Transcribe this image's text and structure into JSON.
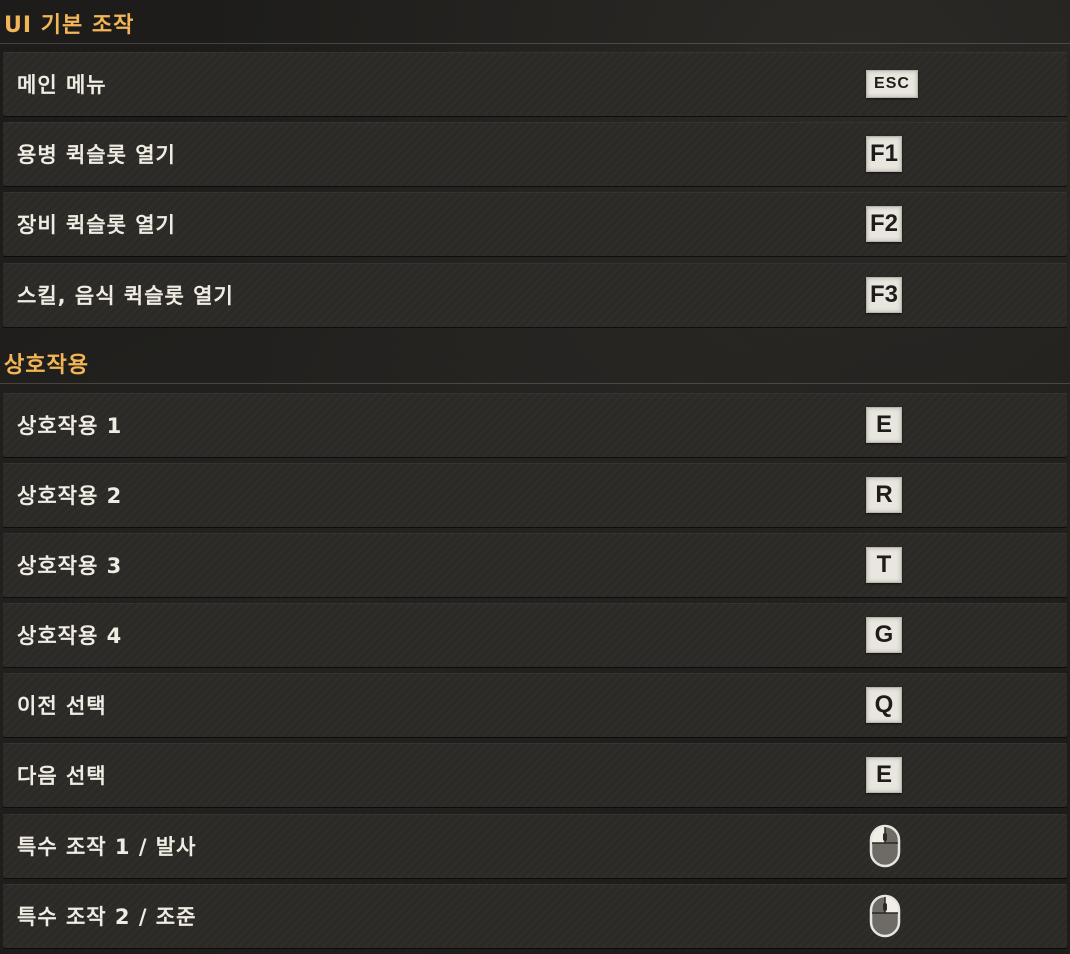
{
  "sections": [
    {
      "title": "UI 기본 조작",
      "items": [
        {
          "label": "메인 메뉴",
          "key": "ESC",
          "icon": "esc-key"
        },
        {
          "label": "용병 퀵슬롯 열기",
          "key": "F1",
          "icon": "f1-key"
        },
        {
          "label": "장비 퀵슬롯 열기",
          "key": "F2",
          "icon": "f2-key"
        },
        {
          "label": "스킬, 음식 퀵슬롯 열기",
          "key": "F3",
          "icon": "f3-key"
        }
      ]
    },
    {
      "title": "상호작용",
      "items": [
        {
          "label": "상호작용 1",
          "key": "E",
          "icon": "e-key"
        },
        {
          "label": "상호작용 2",
          "key": "R",
          "icon": "r-key"
        },
        {
          "label": "상호작용 3",
          "key": "T",
          "icon": "t-key"
        },
        {
          "label": "상호작용 4",
          "key": "G",
          "icon": "g-key"
        },
        {
          "label": "이전 선택",
          "key": "Q",
          "icon": "q-key"
        },
        {
          "label": "다음 선택",
          "key": "E",
          "icon": "e-key"
        },
        {
          "label": "특수 조작 1 / 발사",
          "key": "",
          "icon": "mouse-left-button-icon"
        },
        {
          "label": "특수 조작 2 / 조준",
          "key": "",
          "icon": "mouse-right-button-icon"
        }
      ]
    }
  ],
  "colors": {
    "section_title": "#f3b656",
    "row_bg": "#2b2a27",
    "keycap_bg": "#e9e6df",
    "label": "#f0ece3"
  }
}
